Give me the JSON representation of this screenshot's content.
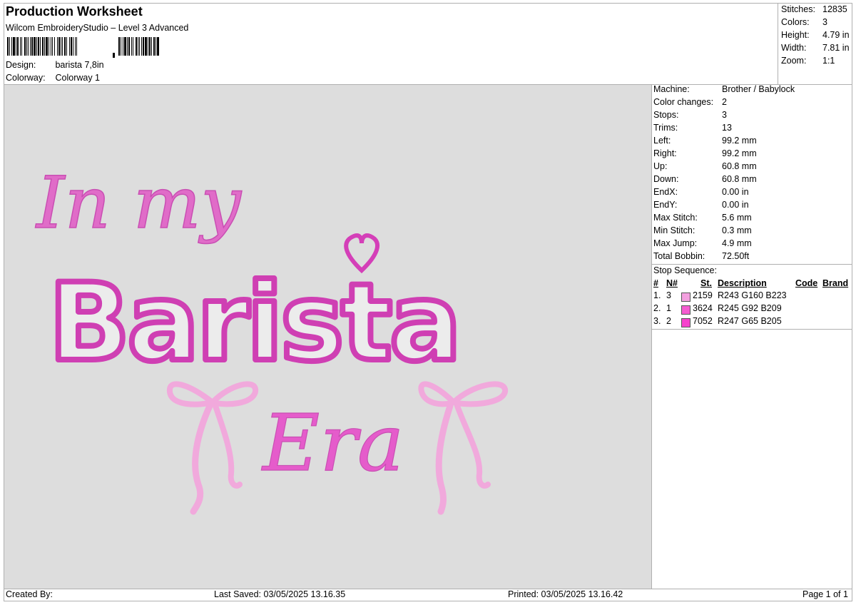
{
  "header": {
    "title": "Production Worksheet",
    "subtitle": "Wilcom EmbroideryStudio – Level 3 Advanced",
    "design_label": "Design:",
    "design_value": "barista 7,8in",
    "colorway_label": "Colorway:",
    "colorway_value": "Colorway 1"
  },
  "summary": [
    {
      "label": "Stitches:",
      "value": "12835"
    },
    {
      "label": "Colors:",
      "value": "3"
    },
    {
      "label": "Height:",
      "value": "4.79 in"
    },
    {
      "label": "Width:",
      "value": "7.81 in"
    },
    {
      "label": "Zoom:",
      "value": "1:1"
    }
  ],
  "design_text": {
    "line1": "In my",
    "line2": "Barista",
    "line3": "Era"
  },
  "properties": [
    {
      "label": "Machine:",
      "value": "Brother / Babylock"
    },
    {
      "label": "Color changes:",
      "value": "2"
    },
    {
      "label": "Stops:",
      "value": "3"
    },
    {
      "label": "Trims:",
      "value": "13"
    },
    {
      "label": "Left:",
      "value": "99.2 mm"
    },
    {
      "label": "Right:",
      "value": "99.2 mm"
    },
    {
      "label": "Up:",
      "value": "60.8 mm"
    },
    {
      "label": "Down:",
      "value": "60.8 mm"
    },
    {
      "label": "EndX:",
      "value": "0.00 in"
    },
    {
      "label": "EndY:",
      "value": "0.00 in"
    },
    {
      "label": "Max Stitch:",
      "value": "5.6 mm"
    },
    {
      "label": "Min Stitch:",
      "value": "0.3 mm"
    },
    {
      "label": "Max Jump:",
      "value": "4.9 mm"
    },
    {
      "label": "Total Bobbin:",
      "value": "72.50ft"
    }
  ],
  "stop_sequence": {
    "title": "Stop Sequence:",
    "headers": {
      "num": "#",
      "n": "N#",
      "st": "St.",
      "desc": "Description",
      "code": "Code",
      "brand": "Brand"
    },
    "rows": [
      {
        "num": "1.",
        "n": "3",
        "st": "2159",
        "desc": "R243 G160 B223",
        "color": "#f3a0df"
      },
      {
        "num": "2.",
        "n": "1",
        "st": "3624",
        "desc": "R245 G92 B209",
        "color": "#f55cd1"
      },
      {
        "num": "3.",
        "n": "2",
        "st": "7052",
        "desc": "R247 G65 B205",
        "color": "#f741cd"
      }
    ]
  },
  "footer": {
    "created_by": "Created By:",
    "last_saved": "Last Saved: 03/05/2025 13.16.35",
    "printed": "Printed: 03/05/2025 13.16.42",
    "page": "Page 1 of 1"
  }
}
